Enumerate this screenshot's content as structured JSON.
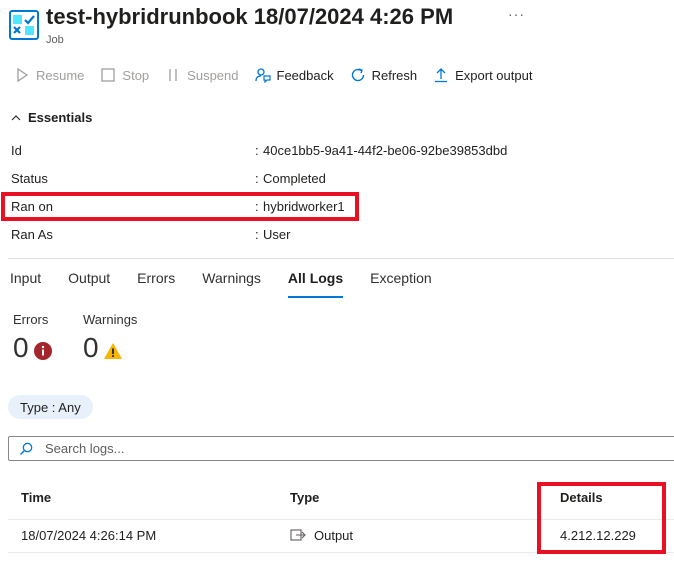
{
  "header": {
    "title": "test-hybridrunbook 18/07/2024 4:26 PM",
    "subtitle": "Job",
    "more": "···",
    "icon": "runbook-job-icon"
  },
  "toolbar": {
    "resume": "Resume",
    "stop": "Stop",
    "suspend": "Suspend",
    "feedback": "Feedback",
    "refresh": "Refresh",
    "export": "Export output"
  },
  "essentials": {
    "title": "Essentials",
    "rows": [
      {
        "key": "Id",
        "value": "40ce1bb5-9a41-44f2-be06-92be39853dbd"
      },
      {
        "key": "Status",
        "value": "Completed"
      },
      {
        "key": "Ran on",
        "value": "hybridworker1"
      },
      {
        "key": "Ran As",
        "value": "User"
      }
    ]
  },
  "tabs": [
    "Input",
    "Output",
    "Errors",
    "Warnings",
    "All Logs",
    "Exception"
  ],
  "active_tab": "All Logs",
  "stats": {
    "errors_label": "Errors",
    "errors_count": "0",
    "warnings_label": "Warnings",
    "warnings_count": "0"
  },
  "filter_pill": "Type : Any",
  "search": {
    "placeholder": "Search logs..."
  },
  "grid": {
    "columns": [
      "Time",
      "Type",
      "Details"
    ],
    "rows": [
      {
        "time": "18/07/2024 4:26:14 PM",
        "type": "Output",
        "details": "4.212.12.229"
      }
    ]
  },
  "colors": {
    "accent": "#0078d4",
    "highlight": "#e81123",
    "error": "#a4262c",
    "warning": "#f8b500",
    "pill_bg": "#e8f1fb"
  }
}
